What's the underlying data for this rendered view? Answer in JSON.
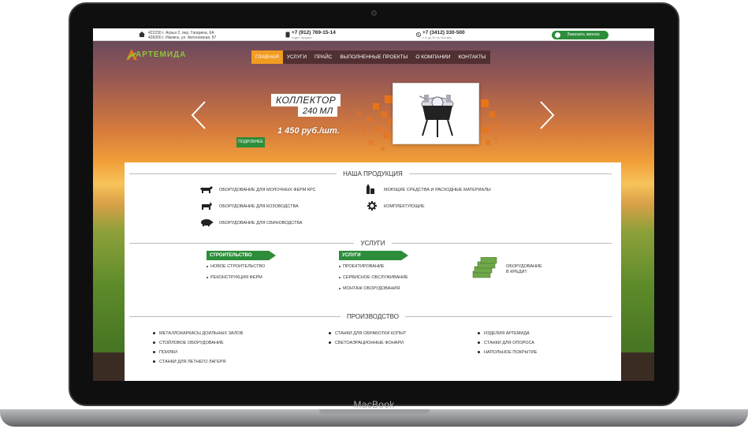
{
  "device": {
    "brand": "MacBook"
  },
  "topbar": {
    "address_line1": "426000 г. Ижевск, ул. Автономная, 87",
    "address_line2": "422230 г. Агрыз 2, пер. Гагарина, 6А",
    "phone1": "+7 (912) 769-15-14",
    "phone1_sub": "отдел продаж",
    "phone2": "+7 (3412) 330-500",
    "phone2_sub": "с 8 до 16 по Москве",
    "callback_label": "Заказать звонок"
  },
  "logo": {
    "text": "АРТЕМИДА"
  },
  "nav": {
    "items": [
      {
        "label": "ГЛАВНАЯ",
        "active": true
      },
      {
        "label": "УСЛУГИ",
        "active": false
      },
      {
        "label": "ПРАЙС",
        "active": false
      },
      {
        "label": "ВЫПОЛНЕННЫЕ ПРОЕКТЫ",
        "active": false
      },
      {
        "label": "О КОМПАНИИ",
        "active": false
      },
      {
        "label": "КОНТАКТЫ",
        "active": false
      }
    ]
  },
  "slider": {
    "title": "КОЛЛЕКТОР",
    "subtitle": "240 МЛ",
    "price": "1 450 руб./шт.",
    "more_label": "ПОДРОБНЕЕ"
  },
  "products": {
    "title": "НАША ПРОДУКЦИЯ",
    "left": [
      {
        "label": "ОБОРУДОВАНИЕ ДЛЯ МОЛОЧНЫХ ФЕРМ КРС",
        "icon": "cow-icon"
      },
      {
        "label": "ОБОРУДОВАНИЕ ДЛЯ КОЗОВОДСТВА",
        "icon": "goat-icon"
      },
      {
        "label": "ОБОРУДОВАНИЕ ДЛЯ СВИНОВОДСТВА",
        "icon": "pig-icon"
      }
    ],
    "right": [
      {
        "label": "МОЮЩИЕ СРЕДСТВА И РАСХОДНЫЕ МАТЕРИАЛЫ",
        "icon": "bottles-icon"
      },
      {
        "label": "КОМПЛЕКТУЮЩИЕ",
        "icon": "gear-icon"
      }
    ]
  },
  "services": {
    "title": "УСЛУГИ",
    "construction_tag": "СТРОИТЕЛЬСТВО",
    "construction_items": [
      "НОВОЕ СТРОИТЕЛЬСТВО",
      "РЕКОНСТРУКЦИЯ ФЕРМ"
    ],
    "services_tag": "УСЛУГИ",
    "services_items": [
      "ПРОЕКТИРОВАНИЕ",
      "СЕРВИСНОЕ ОБСЛУЖИВАНИЕ",
      "МОНТАЖ ОБОРУДОВАНИЯ"
    ],
    "credit_line1": "ОБОРУДОВАНИЕ",
    "credit_line2": "В КРЕДИТ"
  },
  "production": {
    "title": "ПРОИЗВОДСТВО",
    "col1": [
      "МЕТАЛЛОКАРКАСЫ ДОИЛЬНЫХ ЗАЛОВ",
      "СТОЙЛОВОЕ ОБОРУДОВАНИЕ",
      "ПОИЛКИ",
      "СТАНКИ ДЛЯ ЛЕТНЕГО ЛАГЕРЯ"
    ],
    "col2": [
      "СТАНКИ ДЛЯ ОБРАБОТКИ КОПЫТ",
      "СВЕТОАЭРАЦИОННЫЕ ФОНАРИ"
    ],
    "col3": [
      "ИЗДЕЛИЯ АРТЕМИДА",
      "СТАНКИ ДЛЯ ОПОРОСА",
      "НАПОЛЬНОЕ ПОКРЫТИЕ"
    ]
  },
  "colors": {
    "accent_green": "#2d8d3a",
    "accent_orange": "#f29c22"
  }
}
